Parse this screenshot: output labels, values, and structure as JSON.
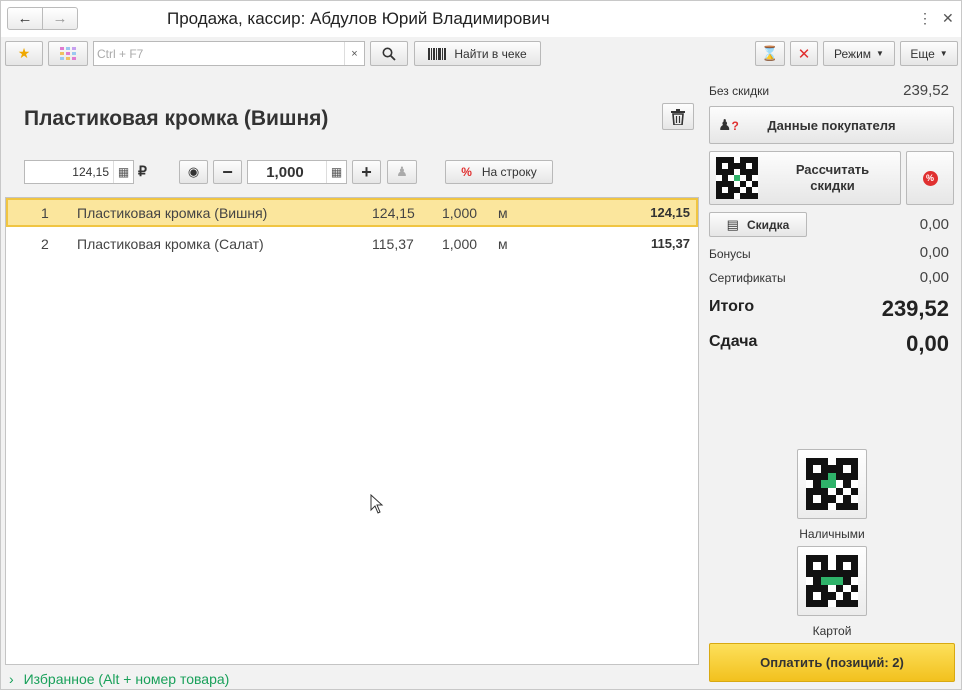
{
  "window": {
    "title": "Продажа, кассир: Абдулов Юрий Владимирович"
  },
  "toolbar": {
    "search_placeholder": "Ctrl + F7",
    "search_clear": "×",
    "find_in_receipt": "Найти в чеке",
    "mode_label": "Режим",
    "more_label": "Еще"
  },
  "product": {
    "title": "Пластиковая кромка (Вишня)",
    "price": "124,15",
    "currency": "₽",
    "quantity": "1,000",
    "to_line_label": "На строку"
  },
  "lines": [
    {
      "num": "1",
      "name": "Пластиковая кромка (Вишня)",
      "price": "124,15",
      "qty": "1,000",
      "unit": "м",
      "sum": "124,15",
      "selected": true
    },
    {
      "num": "2",
      "name": "Пластиковая кромка (Салат)",
      "price": "115,37",
      "qty": "1,000",
      "unit": "м",
      "sum": "115,37",
      "selected": false
    }
  ],
  "favorites": {
    "label": "Избранное (Alt + номер товара)"
  },
  "summary": {
    "no_discount_label": "Без скидки",
    "no_discount_value": "239,52",
    "customer_data_label": "Данные покупателя",
    "calc_discounts_label_1": "Рассчитать",
    "calc_discounts_label_2": "скидки",
    "discount_label": "Скидка",
    "discount_value": "0,00",
    "bonus_label": "Бонусы",
    "bonus_value": "0,00",
    "certificates_label": "Сертификаты",
    "certificates_value": "0,00",
    "total_label": "Итого",
    "total_value": "239,52",
    "change_label": "Сдача",
    "change_value": "0,00"
  },
  "payment": {
    "cash_label": "Наличными",
    "card_label": "Картой",
    "pay_label": "Оплатить (позиций: 2)"
  },
  "colors": {
    "selected_row": "#fbe69d",
    "selected_border": "#f0c542",
    "pay_button": "#f7cf34",
    "favorites_green": "#19a05a",
    "delete_red": "#e03030"
  }
}
